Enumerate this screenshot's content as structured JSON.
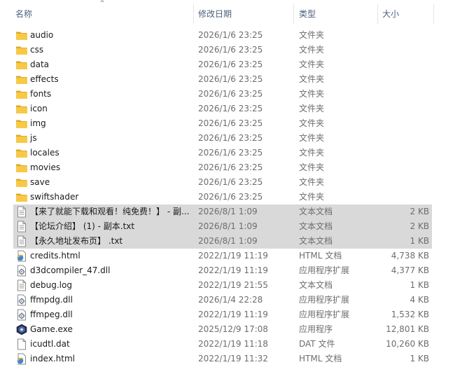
{
  "columns": {
    "name": "名称",
    "date": "修改日期",
    "type": "类型",
    "size": "大小"
  },
  "icons": {
    "folder": "folder-icon",
    "text": "text-file-icon",
    "html": "html-file-icon",
    "dll": "dll-file-icon",
    "exe": "game-exe-icon",
    "dat": "dat-file-icon",
    "sort": "sort-ascending-icon"
  },
  "colors": {
    "folder": "#f7c948",
    "selection": "#d9d9d9",
    "header_text": "#4c607a"
  },
  "files": [
    {
      "name": "audio",
      "date": "2026/1/6 23:25",
      "type": "文件夹",
      "size": "",
      "icon": "folder",
      "selected": false
    },
    {
      "name": "css",
      "date": "2026/1/6 23:25",
      "type": "文件夹",
      "size": "",
      "icon": "folder",
      "selected": false
    },
    {
      "name": "data",
      "date": "2026/1/6 23:25",
      "type": "文件夹",
      "size": "",
      "icon": "folder",
      "selected": false
    },
    {
      "name": "effects",
      "date": "2026/1/6 23:25",
      "type": "文件夹",
      "size": "",
      "icon": "folder",
      "selected": false
    },
    {
      "name": "fonts",
      "date": "2026/1/6 23:25",
      "type": "文件夹",
      "size": "",
      "icon": "folder",
      "selected": false
    },
    {
      "name": "icon",
      "date": "2026/1/6 23:25",
      "type": "文件夹",
      "size": "",
      "icon": "folder",
      "selected": false
    },
    {
      "name": "img",
      "date": "2026/1/6 23:25",
      "type": "文件夹",
      "size": "",
      "icon": "folder",
      "selected": false
    },
    {
      "name": "js",
      "date": "2026/1/6 23:25",
      "type": "文件夹",
      "size": "",
      "icon": "folder",
      "selected": false
    },
    {
      "name": "locales",
      "date": "2026/1/6 23:25",
      "type": "文件夹",
      "size": "",
      "icon": "folder",
      "selected": false
    },
    {
      "name": "movies",
      "date": "2026/1/6 23:25",
      "type": "文件夹",
      "size": "",
      "icon": "folder",
      "selected": false
    },
    {
      "name": "save",
      "date": "2026/1/6 23:25",
      "type": "文件夹",
      "size": "",
      "icon": "folder",
      "selected": false
    },
    {
      "name": "swiftshader",
      "date": "2026/1/6 23:25",
      "type": "文件夹",
      "size": "",
      "icon": "folder",
      "selected": false
    },
    {
      "name": "【来了就能下载和观看！纯免费！】 - 副...",
      "date": "2026/8/1 1:09",
      "type": "文本文档",
      "size": "2 KB",
      "icon": "text",
      "selected": true
    },
    {
      "name": "【论坛介绍】 (1) - 副本.txt",
      "date": "2026/8/1 1:09",
      "type": "文本文档",
      "size": "2 KB",
      "icon": "text",
      "selected": true
    },
    {
      "name": "【永久地址发布页】 .txt",
      "date": "2026/8/1 1:09",
      "type": "文本文档",
      "size": "1 KB",
      "icon": "text",
      "selected": true
    },
    {
      "name": "credits.html",
      "date": "2022/1/19 11:19",
      "type": "HTML 文档",
      "size": "4,738 KB",
      "icon": "html",
      "selected": false
    },
    {
      "name": "d3dcompiler_47.dll",
      "date": "2022/1/19 11:19",
      "type": "应用程序扩展",
      "size": "4,377 KB",
      "icon": "dll",
      "selected": false
    },
    {
      "name": "debug.log",
      "date": "2022/1/19 21:55",
      "type": "文本文档",
      "size": "1 KB",
      "icon": "text",
      "selected": false
    },
    {
      "name": "ffmpdg.dll",
      "date": "2026/1/4 22:28",
      "type": "应用程序扩展",
      "size": "4 KB",
      "icon": "dll",
      "selected": false
    },
    {
      "name": "ffmpeg.dll",
      "date": "2022/1/19 11:19",
      "type": "应用程序扩展",
      "size": "1,532 KB",
      "icon": "dll",
      "selected": false
    },
    {
      "name": "Game.exe",
      "date": "2025/12/9 17:08",
      "type": "应用程序",
      "size": "12,801 KB",
      "icon": "exe",
      "selected": false
    },
    {
      "name": "icudtl.dat",
      "date": "2022/1/19 11:18",
      "type": "DAT 文件",
      "size": "10,260 KB",
      "icon": "dat",
      "selected": false
    },
    {
      "name": "index.html",
      "date": "2022/1/19 11:32",
      "type": "HTML 文档",
      "size": "1 KB",
      "icon": "html",
      "selected": false
    }
  ]
}
